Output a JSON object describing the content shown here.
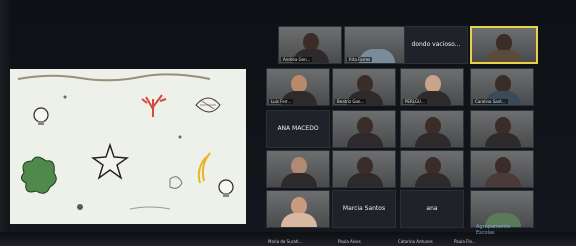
{
  "gallery": {
    "tiles": [
      {
        "label": "Andrea Gen...",
        "type": "video"
      },
      {
        "label": "Rita Farres",
        "type": "video"
      },
      {
        "label": "dondo vacioso...",
        "type": "name"
      },
      {
        "label": "",
        "type": "video-highlight"
      },
      {
        "label": "Luis Ferr...",
        "type": "video"
      },
      {
        "label": "Beatriz Gon...",
        "type": "video"
      },
      {
        "label": "PERLGU...",
        "type": "video"
      },
      {
        "label": "Carolina Sant...",
        "type": "video"
      },
      {
        "label": "ANA MACEDO",
        "type": "name"
      },
      {
        "label": "",
        "type": "video"
      },
      {
        "label": "",
        "type": "video"
      },
      {
        "label": "",
        "type": "video"
      },
      {
        "label": "",
        "type": "video"
      },
      {
        "label": "",
        "type": "video"
      },
      {
        "label": "",
        "type": "video"
      },
      {
        "label": "",
        "type": "video"
      },
      {
        "label": "",
        "type": "video"
      },
      {
        "label": "Marcia Santos",
        "type": "name"
      },
      {
        "label": "ana",
        "type": "name"
      },
      {
        "label": "",
        "type": "video"
      }
    ],
    "bottom_names": [
      "Maria de Surati...",
      "Paula Alves",
      "Catarina Antunes",
      "Paula Flo..."
    ]
  },
  "watermark": {
    "line1": "Agrupamento",
    "line2": "Escolas"
  }
}
